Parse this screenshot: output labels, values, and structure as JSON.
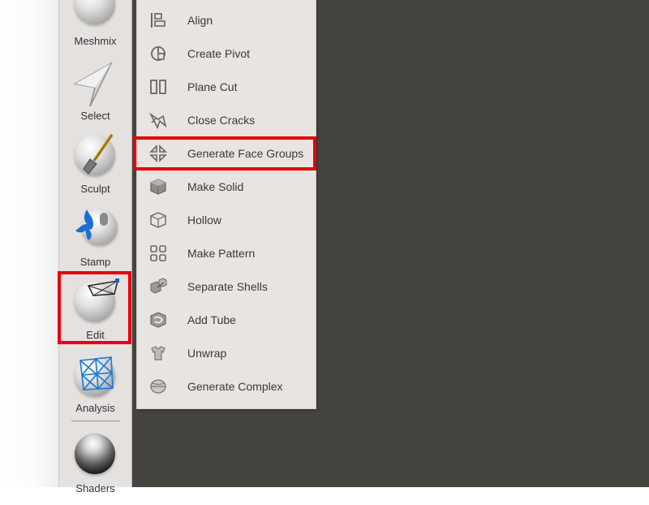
{
  "toolbar": {
    "tools": [
      {
        "label": "Meshmix",
        "icon": "meshmix-head-icon"
      },
      {
        "label": "Select",
        "icon": "select-arrow-icon"
      },
      {
        "label": "Sculpt",
        "icon": "sculpt-brush-icon"
      },
      {
        "label": "Stamp",
        "icon": "stamp-icon"
      },
      {
        "label": "Edit",
        "icon": "edit-mesh-icon"
      },
      {
        "label": "Analysis",
        "icon": "analysis-mesh-icon"
      },
      {
        "label": "Shaders",
        "icon": "shaders-sphere-icon"
      }
    ]
  },
  "edit_menu": {
    "items": [
      {
        "label": "Align",
        "icon": "align-icon"
      },
      {
        "label": "Create Pivot",
        "icon": "create-pivot-icon"
      },
      {
        "label": "Plane Cut",
        "icon": "plane-cut-icon"
      },
      {
        "label": "Close Cracks",
        "icon": "close-cracks-icon"
      },
      {
        "label": "Generate Face Groups",
        "icon": "generate-face-groups-icon"
      },
      {
        "label": "Make Solid",
        "icon": "make-solid-icon"
      },
      {
        "label": "Hollow",
        "icon": "hollow-icon"
      },
      {
        "label": "Make Pattern",
        "icon": "make-pattern-icon"
      },
      {
        "label": "Separate Shells",
        "icon": "separate-shells-icon"
      },
      {
        "label": "Add Tube",
        "icon": "add-tube-icon"
      },
      {
        "label": "Unwrap",
        "icon": "unwrap-icon"
      },
      {
        "label": "Generate Complex",
        "icon": "generate-complex-icon"
      }
    ]
  },
  "highlight_color": "#e8000b",
  "canvas_color": "#45443f"
}
